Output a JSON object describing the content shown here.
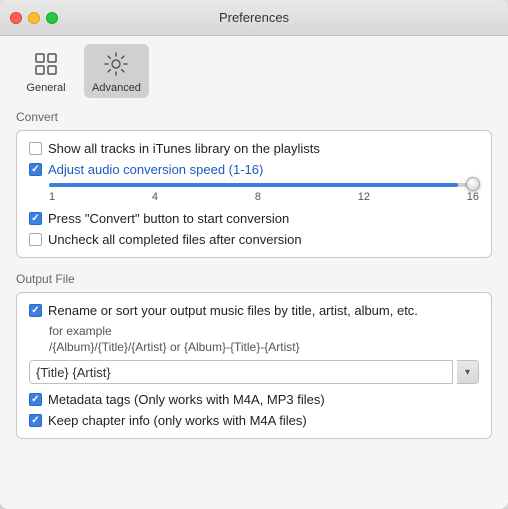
{
  "window": {
    "title": "Preferences"
  },
  "toolbar": {
    "items": [
      {
        "id": "general",
        "label": "General",
        "icon": "⬛",
        "active": false
      },
      {
        "id": "advanced",
        "label": "Advanced",
        "icon": "⚙",
        "active": true
      }
    ]
  },
  "convert_section": {
    "title": "Convert",
    "checkboxes": [
      {
        "id": "show-all-tracks",
        "checked": false,
        "label": "Show all tracks in iTunes library on the playlists"
      },
      {
        "id": "adjust-speed",
        "checked": true,
        "label": "Adjust audio conversion speed (1-16)"
      },
      {
        "id": "press-convert",
        "checked": true,
        "label": "Press \"Convert\" button to start conversion"
      },
      {
        "id": "uncheck-completed",
        "checked": false,
        "label": "Uncheck all completed files after conversion"
      }
    ],
    "slider": {
      "min": 1,
      "max": 16,
      "value": 16,
      "labels": [
        "1",
        "4",
        "8",
        "12",
        "16"
      ],
      "fill_percent": 100
    }
  },
  "output_section": {
    "title": "Output File",
    "rename_checkbox": {
      "id": "rename-sort",
      "checked": true,
      "label": "Rename or sort your output music files by title, artist, album, etc."
    },
    "example_label": "for example",
    "example_path": "/{Album}/{Title}/{Artist} or {Album}-{Title}-{Artist}",
    "input_value": "{Title} {Artist}",
    "input_placeholder": "{Title} {Artist}",
    "dropdown_arrow": "▾",
    "metadata_checkbox": {
      "id": "metadata-tags",
      "checked": true,
      "label": "Metadata tags (Only works with M4A, MP3 files)"
    },
    "chapter_checkbox": {
      "id": "keep-chapter",
      "checked": true,
      "label": "Keep chapter info (only works with  M4A files)"
    }
  }
}
